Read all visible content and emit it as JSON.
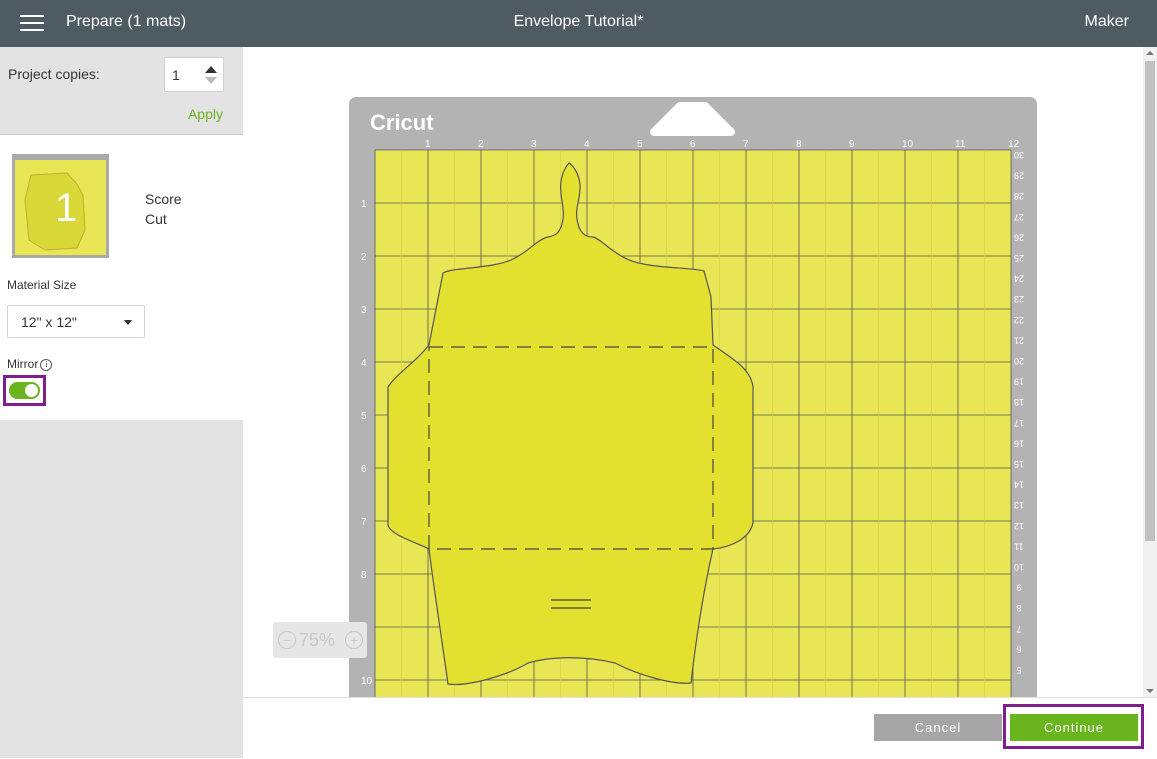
{
  "header": {
    "prepare_title": "Prepare (1 mats)",
    "project_title": "Envelope Tutorial*",
    "machine_name": "Maker"
  },
  "sidebar": {
    "project_copies_label": "Project copies:",
    "project_copies_value": "1",
    "apply_label": "Apply",
    "mat": {
      "number": "1",
      "operations": [
        "Score",
        "Cut"
      ]
    },
    "material_size_label": "Material Size",
    "material_size_value": "12\" x 12\"",
    "mirror_label": "Mirror",
    "mirror_on": true
  },
  "mat": {
    "brand": "Cricut",
    "top_ruler": [
      "1",
      "2",
      "3",
      "4",
      "5",
      "6",
      "7",
      "8",
      "9",
      "10",
      "11",
      "12"
    ],
    "left_ruler": [
      "1",
      "2",
      "3",
      "4",
      "5",
      "6",
      "7",
      "8",
      "9",
      "10"
    ],
    "right_ruler": [
      "30",
      "29",
      "28",
      "27",
      "26",
      "25",
      "24",
      "23",
      "22",
      "21",
      "20",
      "19",
      "18",
      "17",
      "16",
      "15",
      "14",
      "13",
      "12",
      "11",
      "10",
      "9",
      "8",
      "7",
      "6",
      "5"
    ]
  },
  "zoom": {
    "level": "75%"
  },
  "footer": {
    "cancel_label": "Cancel",
    "continue_label": "Continue"
  },
  "colors": {
    "accent_green": "#6ab51e",
    "highlight_purple": "#7f1f8e",
    "mat_yellow": "#e8e654",
    "header_gray": "#4f5b62"
  }
}
